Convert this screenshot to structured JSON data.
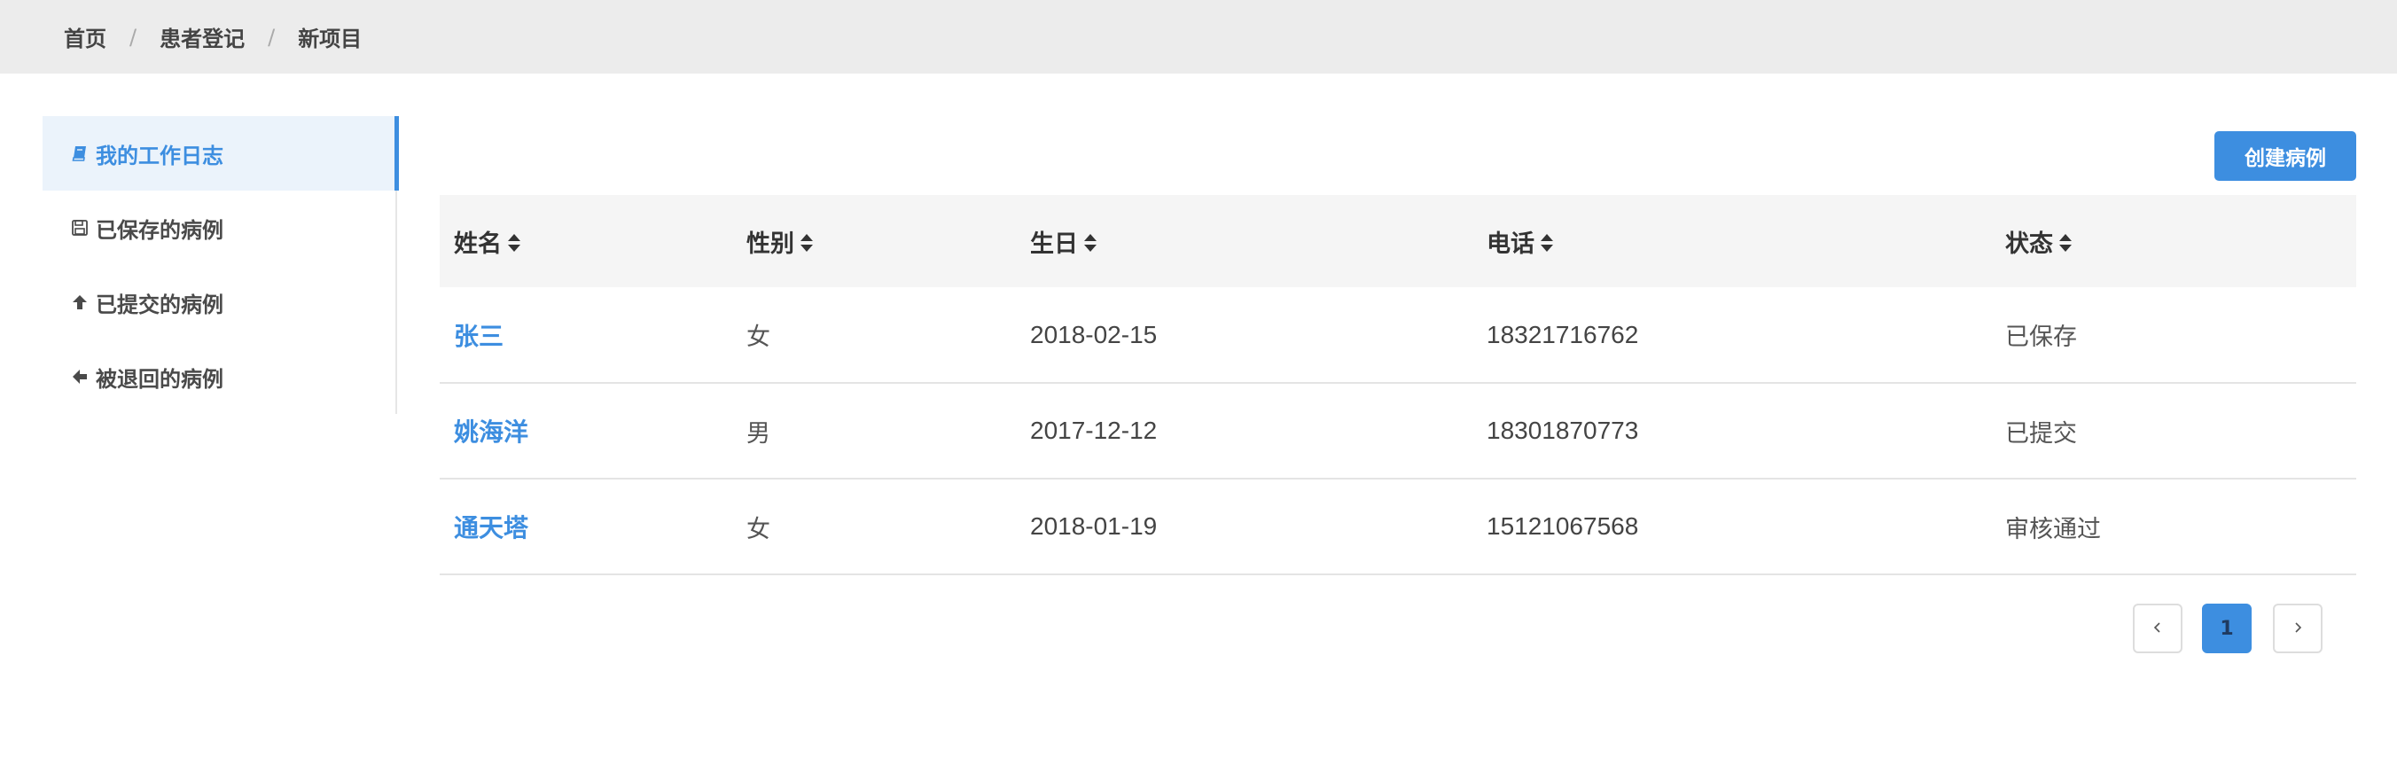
{
  "breadcrumb": [
    "首页",
    "患者登记",
    "新项目"
  ],
  "sidebar": {
    "items": [
      {
        "label": "我的工作日志",
        "icon": "book-icon",
        "active": true
      },
      {
        "label": "已保存的病例",
        "icon": "save-icon",
        "active": false
      },
      {
        "label": "已提交的病例",
        "icon": "arrow-up-icon",
        "active": false
      },
      {
        "label": "被退回的病例",
        "icon": "arrow-left-icon",
        "active": false
      }
    ]
  },
  "toolbar": {
    "create_label": "创建病例"
  },
  "table": {
    "columns": [
      "姓名",
      "性别",
      "生日",
      "电话",
      "状态"
    ],
    "rows": [
      {
        "name": "张三",
        "gender": "女",
        "birthday": "2018-02-15",
        "phone": "18321716762",
        "status": "已保存"
      },
      {
        "name": "姚海洋",
        "gender": "男",
        "birthday": "2017-12-12",
        "phone": "18301870773",
        "status": "已提交"
      },
      {
        "name": "通天塔",
        "gender": "女",
        "birthday": "2018-01-19",
        "phone": "15121067568",
        "status": "审核通过"
      }
    ]
  },
  "pagination": {
    "current": "1"
  },
  "colors": {
    "accent": "#3d8ee0",
    "topbar": "#ececec",
    "active_bg": "#ebf3fb"
  }
}
